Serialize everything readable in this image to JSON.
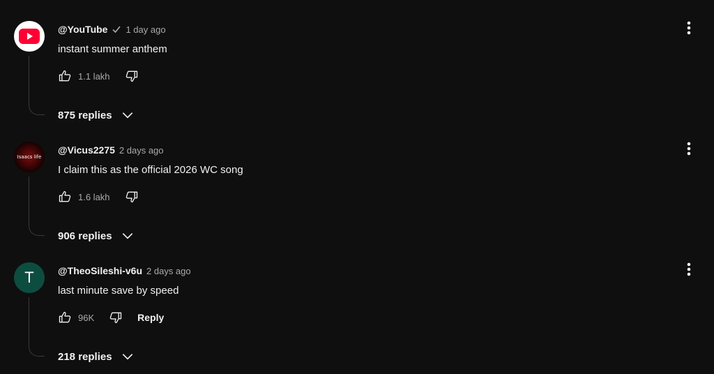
{
  "comments": [
    {
      "avatar": {
        "type": "logo",
        "icon": "youtube-logo-icon"
      },
      "author": "@YouTube",
      "verified": true,
      "time": "1 day ago",
      "text": "instant summer anthem",
      "likes": "1.1 lakh",
      "reply_label": "",
      "replies": "875 replies"
    },
    {
      "avatar": {
        "type": "image",
        "text": "Isaacs life"
      },
      "author": "@Vicus2275",
      "verified": false,
      "time": "2 days ago",
      "text": "I claim this as the official 2026 WC song",
      "likes": "1.6 lakh",
      "reply_label": "",
      "replies": "906 replies"
    },
    {
      "avatar": {
        "type": "letter",
        "text": "T",
        "color": "#0d4d40"
      },
      "author": "@TheoSileshi-v6u",
      "verified": false,
      "time": "2 days ago",
      "text": "last minute save by speed",
      "likes": "96K",
      "reply_label": "Reply",
      "replies": "218 replies"
    }
  ],
  "colors": {
    "background": "#0f0f0f",
    "text_primary": "#f1f1f1",
    "text_secondary": "#aaaaaa",
    "youtube_red": "#ff0033"
  },
  "icons": {
    "like": "thumbs-up-icon",
    "dislike": "thumbs-down-icon",
    "expand": "chevron-down-icon",
    "menu": "more-vertical-icon",
    "verified": "checkmark-icon"
  }
}
